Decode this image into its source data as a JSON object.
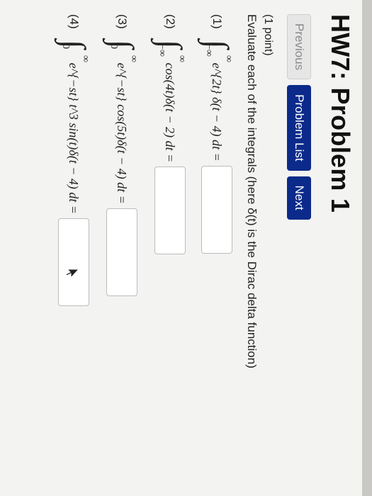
{
  "header": {
    "title": "HW7: Problem 1"
  },
  "nav": {
    "previous": "Previous",
    "problem_list": "Problem List",
    "next": "Next"
  },
  "problem": {
    "points": "(1 point)",
    "instruction": "Evaluate each of the integrals (here δ(t) is the Dirac delta function)",
    "parts": [
      {
        "label": "(1)",
        "upper": "∞",
        "lower": "−∞",
        "integrand": "e^{2t} δ(t − 4) dt =",
        "answer": ""
      },
      {
        "label": "(2)",
        "upper": "∞",
        "lower": "−∞",
        "integrand": "cos(4t)δ(t − 2) dt =",
        "answer": ""
      },
      {
        "label": "(3)",
        "upper": "∞",
        "lower": "0",
        "integrand": "e^{−st} cos(5t)δ(t − 4) dt =",
        "answer": ""
      },
      {
        "label": "(4)",
        "upper": "∞",
        "lower": "0",
        "integrand": "e^{−st} t^3 sin(t)δ(t − 4) dt =",
        "answer": ""
      }
    ]
  },
  "icons": {
    "cursor": "mouse-cursor-icon"
  }
}
